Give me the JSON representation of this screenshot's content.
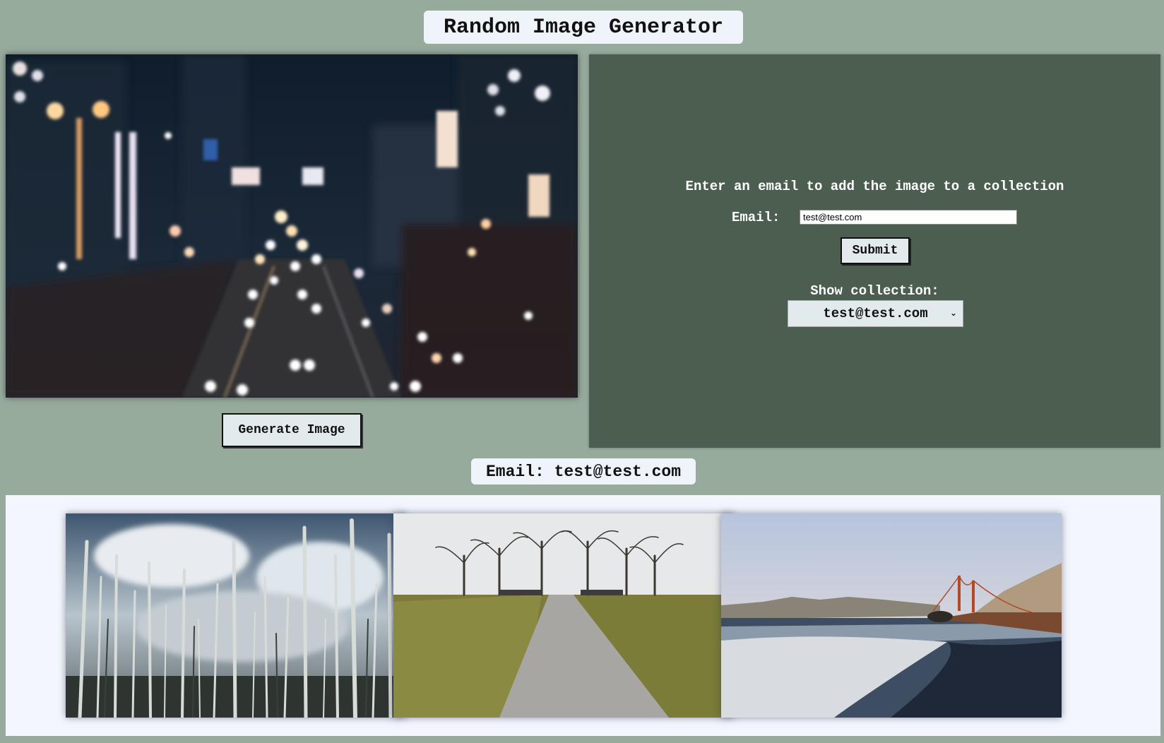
{
  "header": {
    "title": "Random Image Generator"
  },
  "main_image": {
    "alt": "Blurred city street at night with traffic lights"
  },
  "generate_button": {
    "label": "Generate Image"
  },
  "form": {
    "heading": "Enter an email to add the image to a collection",
    "email_label": "Email:",
    "email_value": "test@test.com",
    "submit_label": "Submit",
    "show_collection_label": "Show collection:",
    "selected_collection": "test@test.com"
  },
  "collection": {
    "email_display": "Email: test@test.com",
    "images": [
      {
        "name": "dead-forest-image"
      },
      {
        "name": "tree-path-image"
      },
      {
        "name": "golden-gate-beach-image"
      }
    ]
  },
  "colors": {
    "page_bg": "#97ab9d",
    "panel_bg": "#4b5e50",
    "button_bg": "#e2eaee",
    "collection_bg": "#f3f7fd"
  }
}
